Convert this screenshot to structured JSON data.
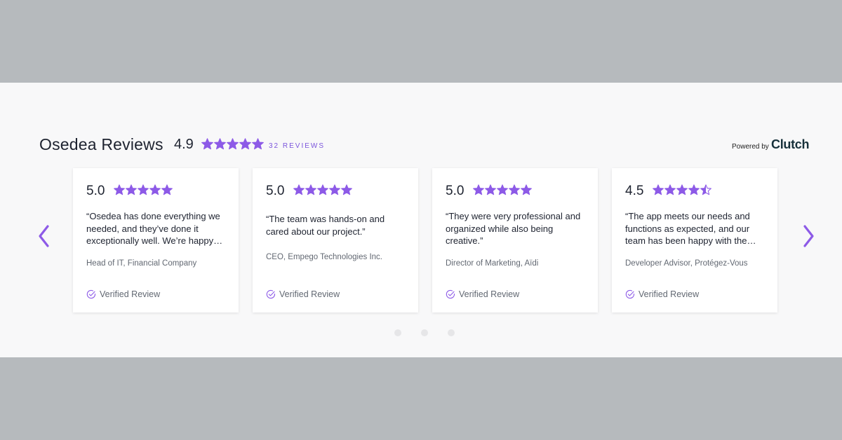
{
  "header": {
    "title": "Osedea Reviews",
    "overall_rating": "4.9",
    "overall_stars": 5,
    "reviews_count": "32 REVIEWS",
    "powered_by": "Powered by",
    "brand": "Clutch"
  },
  "colors": {
    "star": "#8d5ae7",
    "accent": "#7b55dc",
    "outer_background": "#b6babd",
    "panel_background": "#f8f8f9"
  },
  "nav": {
    "prev_icon": "chevron-left-icon",
    "next_icon": "chevron-right-icon"
  },
  "reviews": [
    {
      "rating": "5.0",
      "stars": 5,
      "quote_lines": [
        "“Osedea has done everything we",
        "needed, and they’ve done it",
        "exceptionally well. We’re happy…"
      ],
      "author": "Head of IT, Financial Company",
      "verified": "Verified Review"
    },
    {
      "rating": "5.0",
      "stars": 5,
      "quote_lines": [
        "“The team was hands-on and",
        "cared about our project.”"
      ],
      "author": "CEO, Empego Technologies Inc.",
      "verified": "Verified Review"
    },
    {
      "rating": "5.0",
      "stars": 5,
      "quote_lines": [
        "“They were very professional and",
        "organized while also being",
        "creative.”"
      ],
      "author": "Director of Marketing, Aïdi",
      "verified": "Verified Review"
    },
    {
      "rating": "4.5",
      "stars": 4.5,
      "quote_lines": [
        "“The app meets our needs and",
        "functions as expected, and our",
        "team has been happy with the…"
      ],
      "author": "Developer Advisor, Protégez-Vous",
      "verified": "Verified Review"
    }
  ],
  "pagination": {
    "pages": 3
  }
}
